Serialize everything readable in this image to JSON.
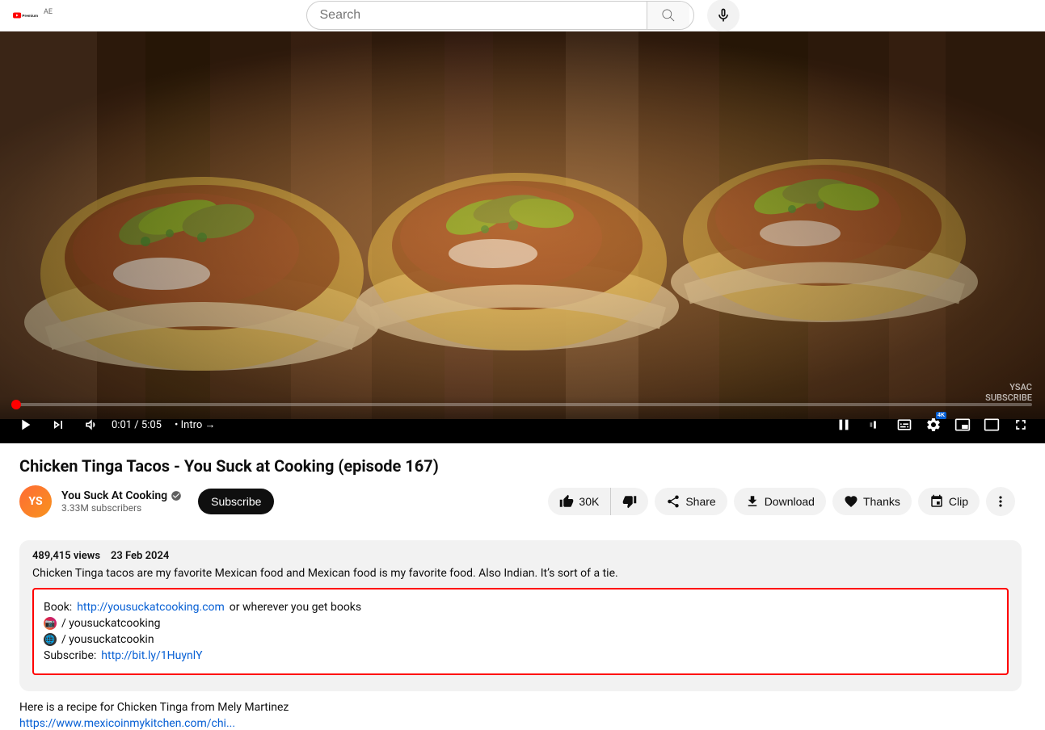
{
  "header": {
    "logo_text": "Premium",
    "ae_badge": "AE",
    "search_placeholder": "Search"
  },
  "video": {
    "title": "Chicken Tinga Tacos - You Suck at Cooking (episode 167)",
    "watermark": "YSAC\nSUBSCRIBE",
    "duration": "5:05",
    "current_time": "0:01",
    "intro_text": "Intro",
    "views": "489,415 views",
    "date": "23 Feb 2024",
    "description": "Chicken Tinga tacos are my favorite Mexican food and Mexican food is my favorite food. Also Indian. It’s sort of a tie.",
    "highlighted": {
      "book_label": "Book: ",
      "book_url": "http://yousuckatcooking.com",
      "book_suffix": " or wherever you get books",
      "instagram_handle": "/ yousuckatcooking",
      "globe_handle": "/ yousuckatcookin",
      "subscribe_label": "Subscribe: ",
      "subscribe_url": "http://bit.ly/1HuynlY"
    },
    "recipe_prefix": "Here is a recipe for Chicken Tinga  from Mely Martinez",
    "recipe_url": "https://www.mexicoinmykitchen.com/chi..."
  },
  "channel": {
    "name": "You Suck At Cooking",
    "verified": true,
    "subscribers": "3.33M subscribers",
    "subscribe_label": "Subscribe"
  },
  "actions": {
    "like_count": "30K",
    "like_label": "30K",
    "share_label": "Share",
    "download_label": "Download",
    "thanks_label": "Thanks",
    "clip_label": "Clip",
    "more_label": "..."
  },
  "player": {
    "progress_percent": 0.3,
    "settings_badge": "4K",
    "intro_arrow": "→"
  }
}
